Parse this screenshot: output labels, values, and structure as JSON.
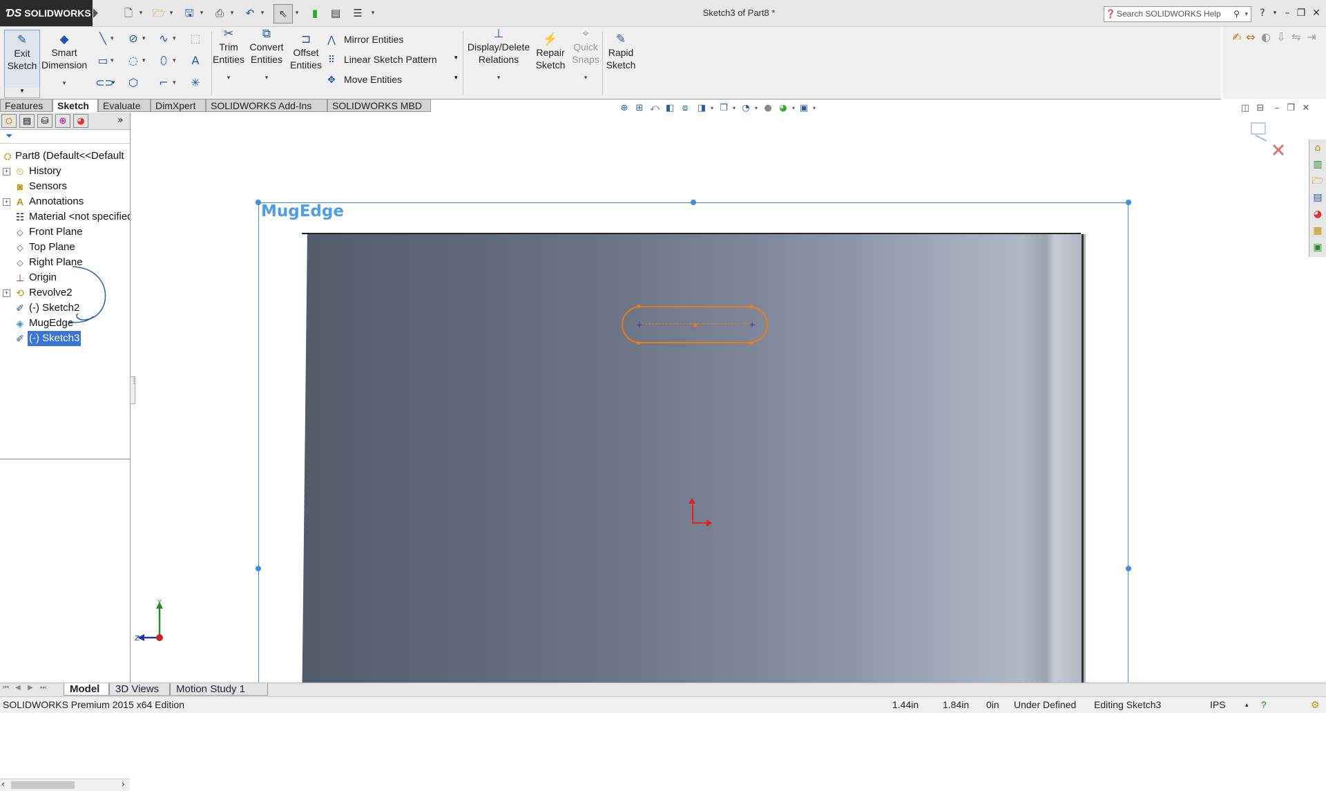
{
  "titlebar": {
    "logo_text": "SOLIDWORKS",
    "document_title": "Sketch3 of Part8 *",
    "search_placeholder": "Search SOLIDWORKS Help"
  },
  "ribbon": {
    "exit_sketch": "Exit Sketch",
    "smart_dimension": "Smart Dimension",
    "trim_entities": "Trim Entities",
    "convert_entities": "Convert Entities",
    "offset_entities": "Offset Entities",
    "mirror_entities": "Mirror Entities",
    "linear_sketch_pattern": "Linear Sketch Pattern",
    "move_entities": "Move Entities",
    "display_delete_relations": "Display/Delete Relations",
    "repair_sketch": "Repair Sketch",
    "quick_snaps": "Quick Snaps",
    "rapid_sketch": "Rapid Sketch"
  },
  "tabs": [
    "Features",
    "Sketch",
    "Evaluate",
    "DimXpert",
    "SOLIDWORKS Add-Ins",
    "SOLIDWORKS MBD"
  ],
  "active_tab": "Sketch",
  "feature_tree": {
    "root": "Part8  (Default<<Default",
    "items": [
      {
        "label": "History",
        "icon": "history-icon",
        "expandable": true
      },
      {
        "label": "Sensors",
        "icon": "sensors-icon",
        "expandable": false
      },
      {
        "label": "Annotations",
        "icon": "annotations-icon",
        "expandable": true
      },
      {
        "label": "Material <not specified>",
        "icon": "material-icon",
        "expandable": false
      },
      {
        "label": "Front Plane",
        "icon": "plane-icon",
        "expandable": false
      },
      {
        "label": "Top Plane",
        "icon": "plane-icon",
        "expandable": false
      },
      {
        "label": "Right Plane",
        "icon": "plane-icon",
        "expandable": false
      },
      {
        "label": "Origin",
        "icon": "origin-icon",
        "expandable": false
      },
      {
        "label": "Revolve2",
        "icon": "revolve-icon",
        "expandable": true
      },
      {
        "label": "(-) Sketch2",
        "icon": "sketch-icon",
        "expandable": false
      },
      {
        "label": "MugEdge",
        "icon": "plane-icon",
        "expandable": false
      },
      {
        "label": "(-) Sketch3",
        "icon": "sketch-icon",
        "expandable": false,
        "selected": true
      }
    ]
  },
  "graphics": {
    "plane_label": "MugEdge",
    "triad_y": "Y",
    "triad_z": "Z"
  },
  "bottom_tabs": [
    "Model",
    "3D Views",
    "Motion Study 1"
  ],
  "active_bottom_tab": "Model",
  "status": {
    "edition": "SOLIDWORKS Premium 2015 x64 Edition",
    "x": "1.44in",
    "y": "1.84in",
    "z": "0in",
    "state": "Under Defined",
    "editing": "Editing Sketch3",
    "units": "IPS"
  },
  "colors": {
    "sketch_geometry": "#e87b16",
    "plane_border": "#3d8fe0",
    "selection": "#3875d7",
    "origin": "#e02020"
  }
}
